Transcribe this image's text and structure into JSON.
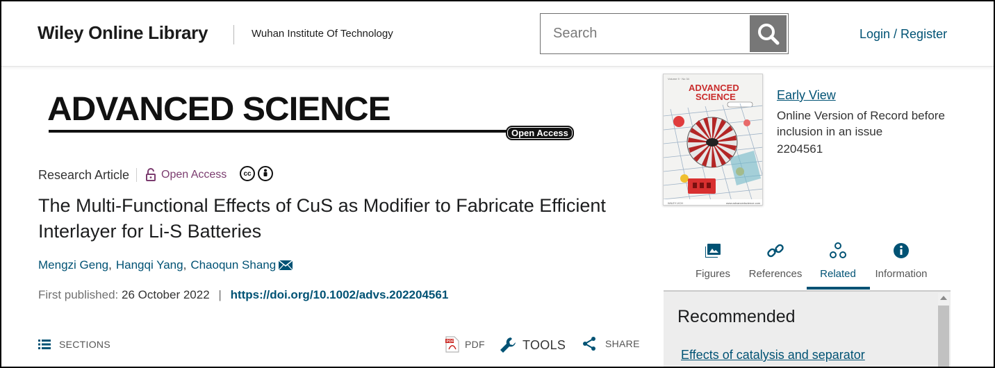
{
  "header": {
    "logo": "Wiley Online Library",
    "institution": "Wuhan Institute Of Technology",
    "search_placeholder": "Search",
    "login_label": "Login / Register",
    "search_icon": "search-icon"
  },
  "journal": {
    "name": "ADVANCED SCIENCE",
    "badge": "Open Access"
  },
  "article": {
    "type": "Research Article",
    "access": "Open Access",
    "license_icons": [
      "cc-icon",
      "by-attribution-icon"
    ],
    "title": "The Multi-Functional Effects of CuS as Modifier to Fabricate Efficient Interlayer for Li-S Batteries",
    "authors": [
      {
        "name": "Mengzi Geng"
      },
      {
        "name": "Hangqi Yang"
      },
      {
        "name": "Chaoqun Shang"
      }
    ],
    "first_published_label": "First published:",
    "first_published_date": "26 October 2022",
    "doi": "https://doi.org/10.1002/advs.202204561"
  },
  "toolbar": {
    "sections": "SECTIONS",
    "pdf": "PDF",
    "tools": "TOOLS",
    "share": "SHARE"
  },
  "sidebar": {
    "early_view": "Early View",
    "early_view_desc": "Online Version of Record before inclusion in an issue",
    "article_number": "2204561",
    "tabs": [
      {
        "label": "Figures",
        "icon": "image-icon"
      },
      {
        "label": "References",
        "icon": "link-icon"
      },
      {
        "label": "Related",
        "icon": "related-icon",
        "active": true
      },
      {
        "label": "Information",
        "icon": "info-icon"
      }
    ],
    "panel_title": "Recommended",
    "recommended_first": "Effects of catalysis and separator"
  },
  "colors": {
    "link": "#005274",
    "open_access": "#7b3c6f",
    "panel_bg": "#ededed"
  }
}
